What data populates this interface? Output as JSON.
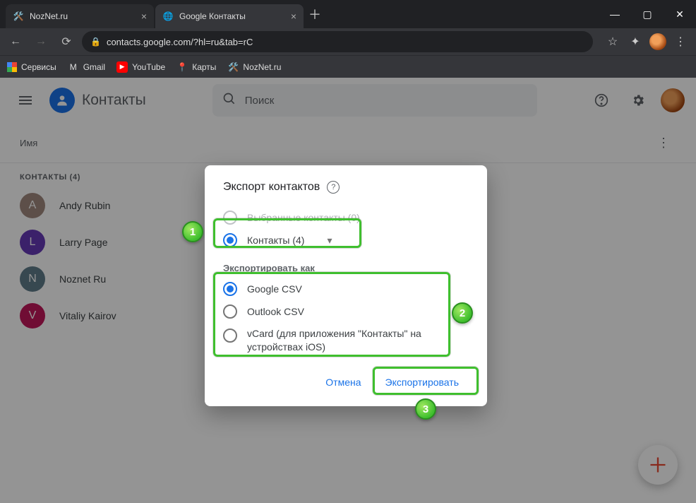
{
  "browser": {
    "tabs": [
      {
        "title": "NozNet.ru"
      },
      {
        "title": "Google Контакты"
      }
    ],
    "url": "contacts.google.com/?hl=ru&tab=rC"
  },
  "bookmarks": [
    {
      "label": "Сервисы"
    },
    {
      "label": "Gmail"
    },
    {
      "label": "YouTube"
    },
    {
      "label": "Карты"
    },
    {
      "label": "NozNet.ru"
    }
  ],
  "contacts": {
    "app_name": "Контакты",
    "search_placeholder": "Поиск",
    "list_header": "Имя",
    "group_label": "КОНТАКТЫ (4)",
    "rows": [
      {
        "initial": "A",
        "name": "Andy Rubin",
        "color": "#a1887f"
      },
      {
        "initial": "L",
        "name": "Larry Page",
        "color": "#673ab7"
      },
      {
        "initial": "N",
        "name": "Noznet Ru",
        "color": "#607d8b"
      },
      {
        "initial": "V",
        "name": "Vitaliy Kairov",
        "color": "#c2185b"
      }
    ]
  },
  "dialog": {
    "title": "Экспорт контактов",
    "option_selected_label": "Выбранные контакты (0)",
    "option_contacts_label": "Контакты (4)",
    "export_as": "Экспортировать как",
    "formats": {
      "google_csv": "Google CSV",
      "outlook_csv": "Outlook CSV",
      "vcard": "vCard (для приложения \"Контакты\" на устройствах iOS)"
    },
    "cancel": "Отмена",
    "export": "Экспортировать"
  },
  "callouts": {
    "c1": "1",
    "c2": "2",
    "c3": "3"
  }
}
